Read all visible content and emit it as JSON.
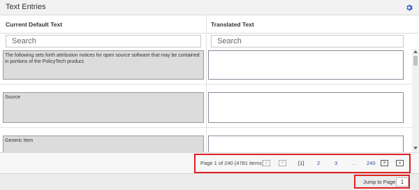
{
  "panel": {
    "title": "Text Entries"
  },
  "columns": {
    "default_header": "Current Default Text",
    "translated_header": "Translated Text"
  },
  "search": {
    "default_placeholder": "Search",
    "translated_placeholder": "Search"
  },
  "rows": [
    {
      "default_text": "The following sets forth attribution notices for open source software that may be contained in portions of the PolicyTech product.",
      "translated_text": ""
    },
    {
      "default_text": "Source",
      "translated_text": ""
    },
    {
      "default_text": "Generic Item",
      "translated_text": ""
    }
  ],
  "pager": {
    "info": "Page 1 of 240 (4781 items)",
    "first_label": "«",
    "prev_label": "<",
    "next_label": ">",
    "last_label": "»",
    "current": "[1]",
    "pages": [
      "2",
      "3"
    ],
    "ellipsis": "...",
    "last_page": "240"
  },
  "jump": {
    "label": "Jump to Page",
    "value": "1"
  },
  "icons": {
    "settings": "gear-icon"
  },
  "colors": {
    "accent": "#2a4aa8",
    "highlight": "#e02020",
    "gear": "#2b5fc9"
  }
}
